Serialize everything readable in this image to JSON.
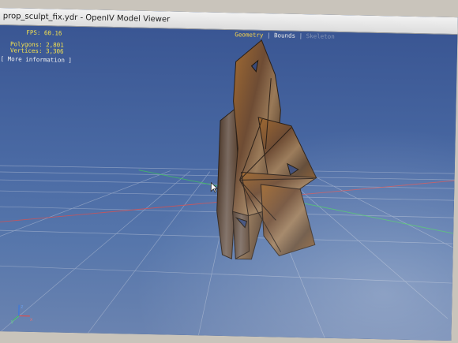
{
  "window": {
    "title": "prop_sculpt_fix.ydr - OpenIV Model Viewer"
  },
  "stats": {
    "fps": "FPS: 60.16",
    "polygons": "Polygons: 2,801",
    "vertices": "Vertices: 3,306",
    "more_info": "[ More information ]"
  },
  "view_tabs": {
    "geometry": "Geometry",
    "separator": "|",
    "bounds": "Bounds",
    "third": "Skeleton"
  },
  "axis_labels": {
    "x": "x",
    "y": "y",
    "z": "z"
  },
  "icons": {
    "axis_gizmo": "axis-gizmo-icon",
    "cursor": "mouse-cursor-icon"
  },
  "colors": {
    "viewport_bg": "#4a6aa4",
    "stats_text": "#f3e04e",
    "active_tab": "#f7d34a",
    "grid": "#b8c2d6",
    "axis_x": "#d85050",
    "axis_y": "#40c060",
    "axis_z": "#3a78e0",
    "model": "#8a5a2a"
  }
}
